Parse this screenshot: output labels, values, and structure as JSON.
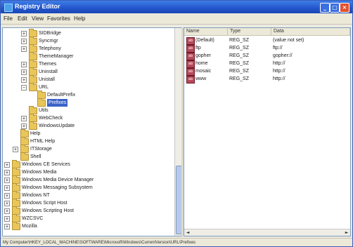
{
  "window": {
    "title": "Registry Editor"
  },
  "titlebar_buttons": {
    "minimize": "_",
    "maximize": "□",
    "close": "×"
  },
  "menu": [
    "File",
    "Edit",
    "View",
    "Favorites",
    "Help"
  ],
  "tree": [
    {
      "label": "SIDBridge",
      "expander": "+"
    },
    {
      "label": "Syncmgr",
      "expander": "+"
    },
    {
      "label": "Telephony",
      "expander": "+"
    },
    {
      "label": "ThemeManager",
      "expander": ""
    },
    {
      "label": "Themes",
      "expander": "+"
    },
    {
      "label": "Uninstall",
      "expander": "+"
    },
    {
      "label": "Unistall",
      "expander": "+"
    },
    {
      "label": "URL",
      "expander": "−"
    },
    {
      "label": "DefaultPrefix",
      "expander": ""
    },
    {
      "label": "Prefixes",
      "expander": "",
      "selected": true
    },
    {
      "label": "Utils",
      "expander": ""
    },
    {
      "label": "WebCheck",
      "expander": "+"
    },
    {
      "label": "WindowsUpdate",
      "expander": "+"
    },
    {
      "label": "Help",
      "expander": ""
    },
    {
      "label": "HTML Help",
      "expander": ""
    },
    {
      "label": "ITStorage",
      "expander": "+"
    },
    {
      "label": "Shell",
      "expander": ""
    },
    {
      "label": "Windows CE Services",
      "expander": "+"
    },
    {
      "label": "Windows Media",
      "expander": "+"
    },
    {
      "label": "Windows Media Device Manager",
      "expander": "+"
    },
    {
      "label": "Windows Messaging Subsystem",
      "expander": "+"
    },
    {
      "label": "Windows NT",
      "expander": "+"
    },
    {
      "label": "Windows Script Host",
      "expander": "+"
    },
    {
      "label": "Windows Scripting Host",
      "expander": "+"
    },
    {
      "label": "WZCSVC",
      "expander": "+"
    },
    {
      "label": "Mozilla",
      "expander": "+"
    }
  ],
  "columns": {
    "name": "Name",
    "type": "Type",
    "data": "Data"
  },
  "values": [
    {
      "icon": "ab",
      "name": "(Default)",
      "type": "REG_SZ",
      "data": "(value not set)"
    },
    {
      "icon": "ab",
      "name": "ftp",
      "type": "REG_SZ",
      "data": "ftp://"
    },
    {
      "icon": "ab",
      "name": "gopher",
      "type": "REG_SZ",
      "data": "gopher://"
    },
    {
      "icon": "ab",
      "name": "home",
      "type": "REG_SZ",
      "data": "http://"
    },
    {
      "icon": "ab",
      "name": "mosaic",
      "type": "REG_SZ",
      "data": "http://"
    },
    {
      "icon": "ab",
      "name": "www",
      "type": "REG_SZ",
      "data": "http://"
    }
  ],
  "scroll_arrows": {
    "left": "◄",
    "right": "►"
  },
  "status": "My Computer\\HKEY_LOCAL_MACHINE\\SOFTWARE\\Microsoft\\Windows\\CurrentVersion\\URL\\Prefixes",
  "icons": {
    "title": "registry-editor-icon",
    "tree_item": "folder-icon",
    "value": "string-value-icon"
  },
  "colors": {
    "titlebar": "#2255cc",
    "selection": "#3a62c8",
    "close": "#e0512f"
  }
}
